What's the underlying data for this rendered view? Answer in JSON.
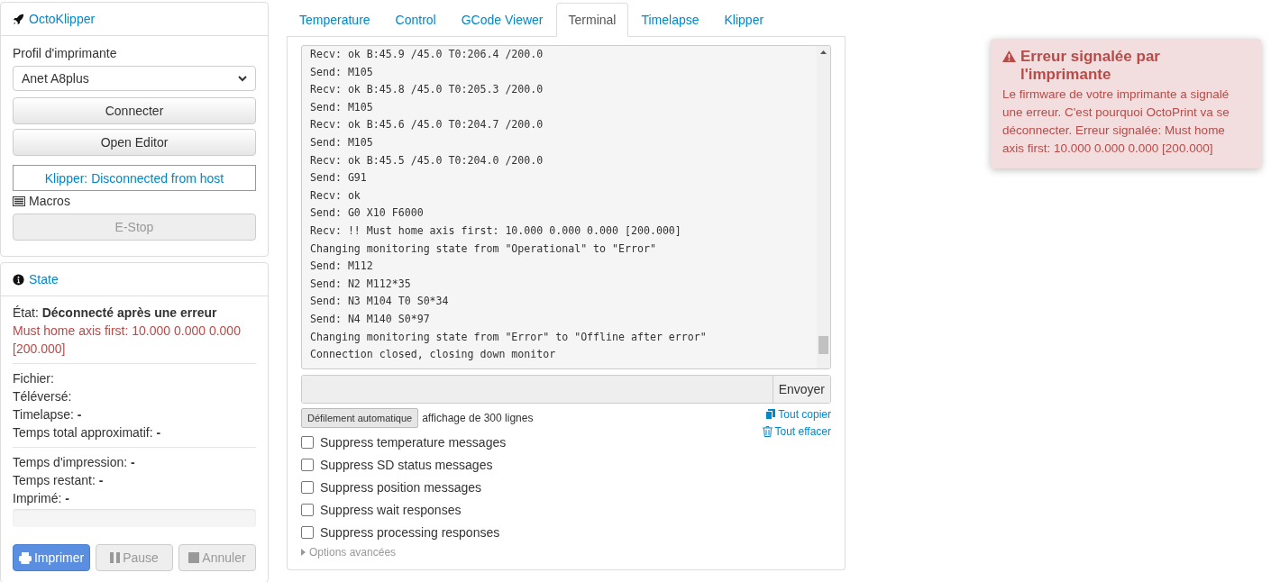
{
  "connection": {
    "title": "OctoKlipper",
    "profile_label": "Profil d'imprimante",
    "profile_value": "Anet A8plus",
    "buttons": [
      {
        "label": "Connecter",
        "disabled": false
      },
      {
        "label": "Open Editor",
        "disabled": false
      }
    ],
    "klipper_status": "Klipper: Disconnected from host",
    "macros_label": "Macros",
    "estop": {
      "label": "E-Stop",
      "disabled": true
    }
  },
  "state": {
    "title": "State",
    "state_label": "État:",
    "state_value": "Déconnecté après une erreur",
    "error_text": "Must home axis first: 10.000 0.000 0.000 [200.000]",
    "groups": [
      [
        "Fichier:",
        "Téléversé:",
        "Timelapse: **-**",
        "Temps total approximatif: **-**"
      ],
      [
        "Temps d'impression: **-**",
        "Temps restant: **-**",
        "Imprimé: **-**"
      ]
    ],
    "progress": {
      "level": 0
    },
    "buttons": [
      {
        "label": "Imprimer",
        "kind": "print",
        "primary": true,
        "disabled": false
      },
      {
        "label": "Pause",
        "kind": "pause",
        "primary": false,
        "disabled": true
      },
      {
        "label": "Annuler",
        "kind": "cancel",
        "primary": false,
        "disabled": true
      }
    ]
  },
  "tabs": [
    {
      "label": "Temperature",
      "selected": false
    },
    {
      "label": "Control",
      "selected": false
    },
    {
      "label": "GCode Viewer",
      "selected": false
    },
    {
      "label": "Terminal",
      "selected": true
    },
    {
      "label": "Timelapse",
      "selected": false
    },
    {
      "label": "Klipper",
      "selected": false
    }
  ],
  "terminal": {
    "log": [
      "Recv: ok B:45.9 /45.0 T0:206.4 /200.0",
      "Send: M105",
      "Recv: ok B:45.8 /45.0 T0:205.3 /200.0",
      "Send: M105",
      "Recv: ok B:45.6 /45.0 T0:204.7 /200.0",
      "Send: M105",
      "Recv: ok B:45.5 /45.0 T0:204.0 /200.0",
      "Send: G91",
      "Recv: ok",
      "Send: G0 X10 F6000",
      "Recv: !! Must home axis first: 10.000 0.000 0.000 [200.000]",
      "Changing monitoring state from \"Operational\" to \"Error\"",
      "Send: M112",
      "Send: N2 M112*35",
      "Send: N3 M104 T0 S0*34",
      "Send: N4 M140 S0*97",
      "Changing monitoring state from \"Error\" to \"Offline after error\"",
      "Connection closed, closing down monitor"
    ],
    "send_label": "Envoyer",
    "autoscroll_label": "Défilement automatique",
    "line_info": "affichage de 300 lignes",
    "copy_label": "Tout copier",
    "clear_label": "Tout effacer",
    "options": [
      {
        "label": "Suppress temperature messages",
        "checked": false
      },
      {
        "label": "Suppress SD status messages",
        "checked": false
      },
      {
        "label": "Suppress position messages",
        "checked": false
      },
      {
        "label": "Suppress wait responses",
        "checked": false
      },
      {
        "label": "Suppress processing responses",
        "checked": false
      }
    ],
    "advanced_label": "Options avancées"
  },
  "notification": {
    "title": "Erreur signalée par l'imprimante",
    "message": "Le firmware de votre imprimante a signalé une erreur. C'est pourquoi OctoPrint va se déconnecter. Erreur signalée: Must home axis first: 10.000 0.000 0.000 [200.000]"
  }
}
